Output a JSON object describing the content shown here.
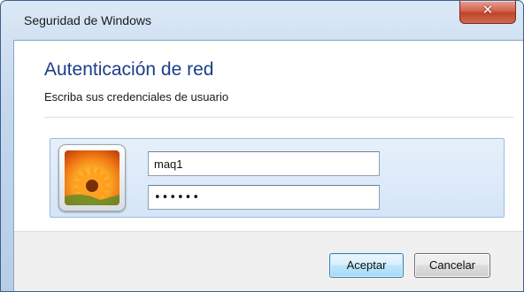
{
  "window": {
    "title": "Seguridad de Windows",
    "close_icon": "close-icon",
    "close_glyph": "✕"
  },
  "dialog": {
    "heading": "Autenticación de red",
    "subheading": "Escriba sus credenciales de usuario"
  },
  "credentials": {
    "avatar_icon": "user-tile-flower-icon",
    "username": "maq1",
    "password_masked": "••••••"
  },
  "buttons": {
    "ok_label": "Aceptar",
    "cancel_label": "Cancelar"
  },
  "colors": {
    "heading": "#1c3e8a",
    "close_button": "#c0442b",
    "tile_background": "#dbe9f8",
    "default_button_border": "#3c7fb1"
  }
}
